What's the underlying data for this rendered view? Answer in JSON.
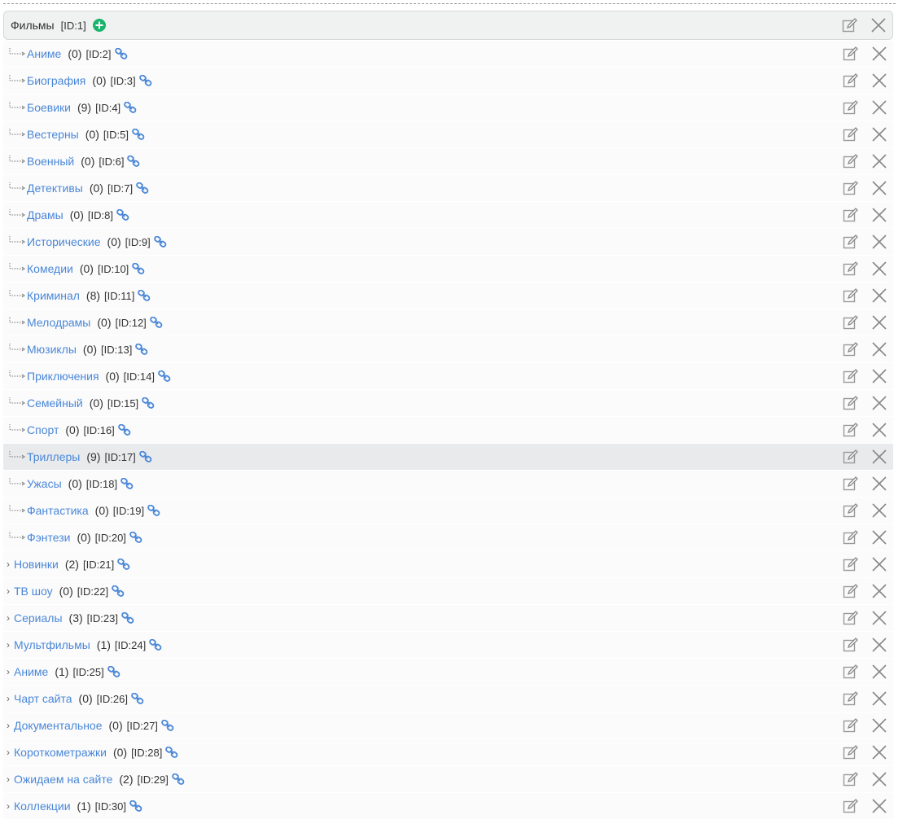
{
  "root": {
    "title": "Фильмы",
    "id": "[ID:1]"
  },
  "children": [
    {
      "label": "Аниме",
      "count": "(0)",
      "id": "[ID:2]"
    },
    {
      "label": "Биография",
      "count": "(0)",
      "id": "[ID:3]"
    },
    {
      "label": "Боевики",
      "count": "(9)",
      "id": "[ID:4]"
    },
    {
      "label": "Вестерны",
      "count": "(0)",
      "id": "[ID:5]"
    },
    {
      "label": "Военный",
      "count": "(0)",
      "id": "[ID:6]"
    },
    {
      "label": "Детективы",
      "count": "(0)",
      "id": "[ID:7]"
    },
    {
      "label": "Драмы",
      "count": "(0)",
      "id": "[ID:8]"
    },
    {
      "label": "Исторические",
      "count": "(0)",
      "id": "[ID:9]"
    },
    {
      "label": "Комедии",
      "count": "(0)",
      "id": "[ID:10]"
    },
    {
      "label": "Криминал",
      "count": "(8)",
      "id": "[ID:11]"
    },
    {
      "label": "Мелодрамы",
      "count": "(0)",
      "id": "[ID:12]"
    },
    {
      "label": "Мюзиклы",
      "count": "(0)",
      "id": "[ID:13]"
    },
    {
      "label": "Приключения",
      "count": "(0)",
      "id": "[ID:14]"
    },
    {
      "label": "Семейный",
      "count": "(0)",
      "id": "[ID:15]"
    },
    {
      "label": "Спорт",
      "count": "(0)",
      "id": "[ID:16]"
    },
    {
      "label": "Триллеры",
      "count": "(9)",
      "id": "[ID:17]",
      "highlighted": true
    },
    {
      "label": "Ужасы",
      "count": "(0)",
      "id": "[ID:18]"
    },
    {
      "label": "Фантастика",
      "count": "(0)",
      "id": "[ID:19]"
    },
    {
      "label": "Фэнтези",
      "count": "(0)",
      "id": "[ID:20]"
    }
  ],
  "top_level": [
    {
      "label": "Новинки",
      "count": "(2)",
      "id": "[ID:21]"
    },
    {
      "label": "ТВ шоу",
      "count": "(0)",
      "id": "[ID:22]"
    },
    {
      "label": "Сериалы",
      "count": "(3)",
      "id": "[ID:23]"
    },
    {
      "label": "Мультфильмы",
      "count": "(1)",
      "id": "[ID:24]"
    },
    {
      "label": "Аниме",
      "count": "(1)",
      "id": "[ID:25]"
    },
    {
      "label": "Чарт сайта",
      "count": "(0)",
      "id": "[ID:26]"
    },
    {
      "label": "Документальное",
      "count": "(0)",
      "id": "[ID:27]"
    },
    {
      "label": "Короткометражки",
      "count": "(0)",
      "id": "[ID:28]"
    },
    {
      "label": "Ожидаем на сайте",
      "count": "(2)",
      "id": "[ID:29]"
    },
    {
      "label": "Коллекции",
      "count": "(1)",
      "id": "[ID:30]"
    }
  ],
  "icons": {
    "add": "plus-circle-icon",
    "link": "link-icon",
    "edit": "edit-icon",
    "delete": "close-icon",
    "tree": "tree-branch-icon",
    "caret": "chevron-right-icon"
  },
  "colors": {
    "link": "#4a87d8",
    "add": "#1cb46c",
    "highlight": "#e9eaec"
  }
}
